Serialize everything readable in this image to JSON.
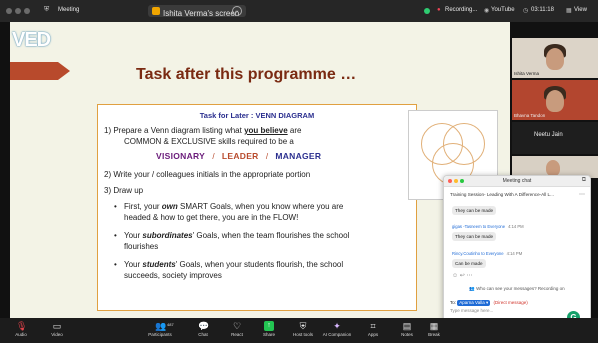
{
  "topbar": {
    "app": "Meeting",
    "share_label": "Ishita Verma's screen",
    "recording": "Recording...",
    "youtube": "YouTube",
    "time": "03:11:18",
    "view": "View"
  },
  "slide": {
    "logo": "VED",
    "title": "Task after this programme …",
    "box_heading": "Task for Later : VENN DIAGRAM",
    "p1_a": "1)   Prepare a Venn diagram listing what ",
    "p1_em": "you believe",
    "p1_b": " are",
    "p1_line2": "COMMON & EXCLUSIVE skills required to be a",
    "keywords": [
      "VISIONARY",
      "LEADER",
      "MANAGER"
    ],
    "sep": "/",
    "p2": "2)  Write your / colleagues initials in the appropriate portion",
    "p3": "3)  Draw up",
    "b1_a": "First, your ",
    "b1_em": "own",
    "b1_b": " SMART Goals, when you know where you are",
    "b1_line2": "headed & how to get there, you are in the FLOW!",
    "b2_a": "Your ",
    "b2_em": "subordinates",
    "b2_b": "' Goals, when the team flourishes the school",
    "b2_line2": "flourishes",
    "b3_a": "Your ",
    "b3_em": "students",
    "b3_b": "' Goals, when your students flourish, the school",
    "b3_line2": "succeeds, society improves"
  },
  "participants": [
    {
      "name": "Ishita Verma"
    },
    {
      "name": "Bhavna Tandon"
    },
    {
      "name": "Neetu Jain"
    }
  ],
  "chat": {
    "title": "Meeting chat",
    "session": "Training Session- Leading With A Difference-All L...",
    "messages": [
      {
        "sender": "",
        "time": "",
        "text": "They can be made"
      },
      {
        "sender": "gigas -Tasneem to Everyone",
        "time": "4:14 PM",
        "text": "They can be made"
      },
      {
        "sender": "Rincy.Coutinho to Everyone",
        "time": "4:14 PM",
        "text": "Can be made"
      }
    ],
    "visibility_note": "Who can see your messages? Recording on",
    "to_label": "To:",
    "recipient": "Aparna Valla",
    "direct": "(Direct message)",
    "placeholder": "Type message here..."
  },
  "toolbar": {
    "audio": "Audio",
    "video": "Video",
    "participants": "Participants",
    "participants_count": "487",
    "chat": "Chat",
    "react": "React",
    "share": "Share",
    "host_tools": "Host tools",
    "ai_companion": "AI Companion",
    "apps": "Apps",
    "notes": "Notes",
    "breakout": "Break"
  },
  "colors": {
    "title": "#7a2a12",
    "keywords": "#2b2f8f",
    "accent_orange": "#b84a2c",
    "chat_blue": "#1f6bd6"
  }
}
